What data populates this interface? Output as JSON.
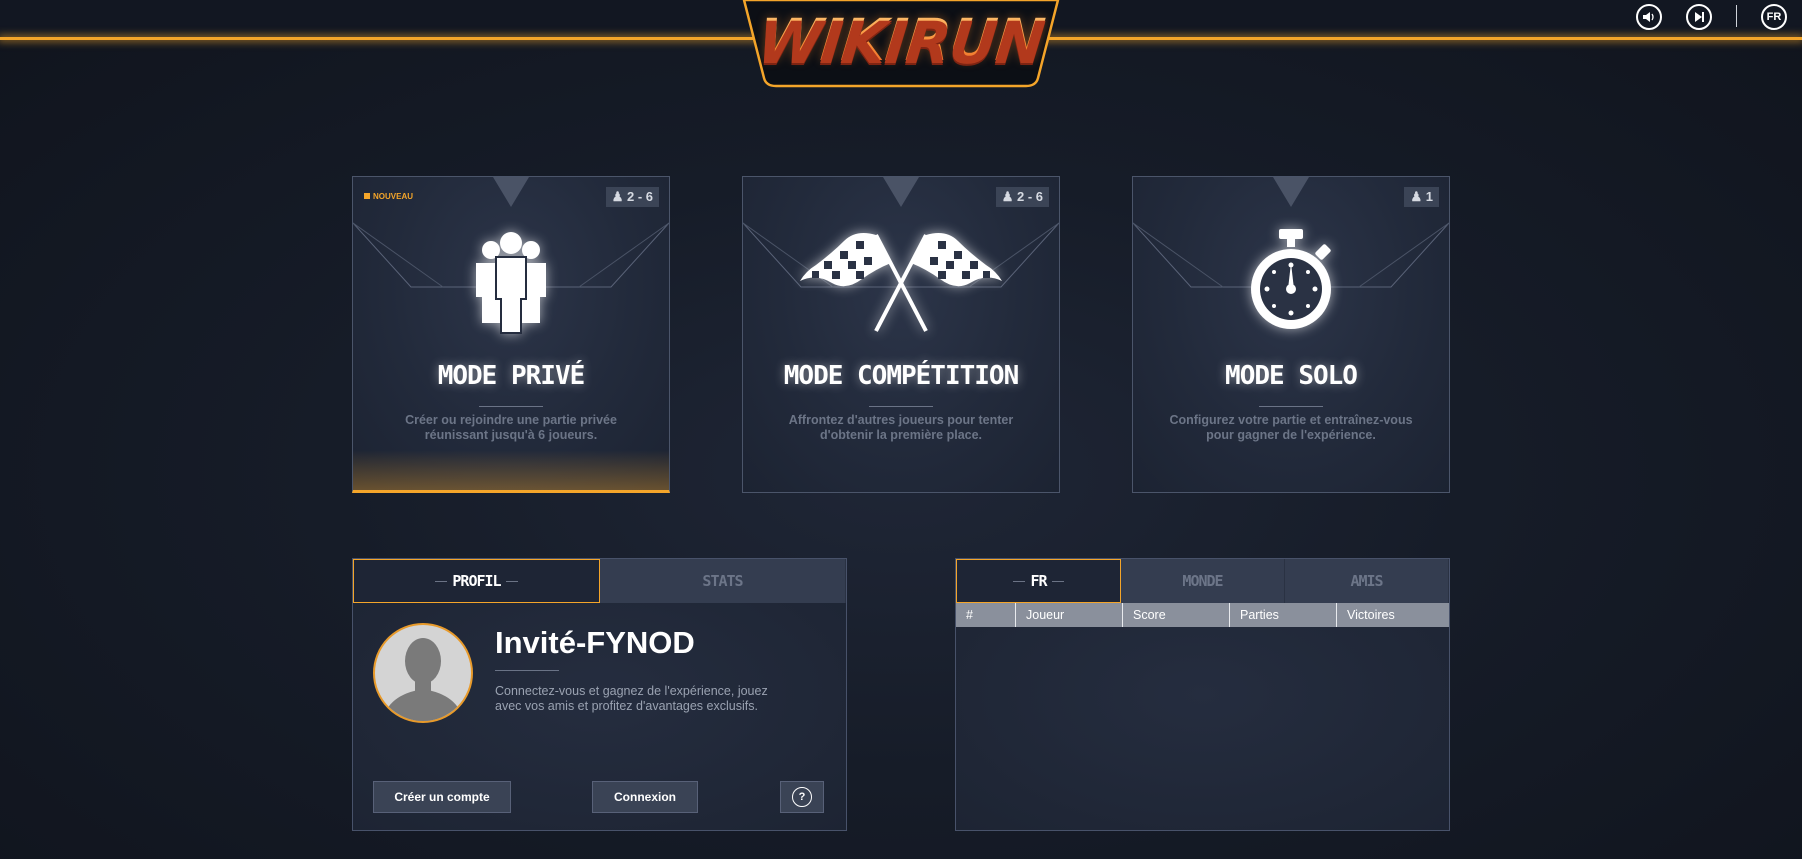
{
  "header": {
    "logo": "WIKIRUN",
    "language": "FR",
    "sound_icon": "speaker-icon",
    "skip_icon": "skip-next-icon"
  },
  "modes": [
    {
      "tag": "NOUVEAU",
      "players": "2 - 6",
      "icon": "group-icon",
      "title": "MODE PRIVÉ",
      "description": "Créer ou rejoindre une partie privée réunissant jusqu'à 6 joueurs."
    },
    {
      "players": "2 - 6",
      "icon": "checkered-flags-icon",
      "title": "MODE COMPÉTITION",
      "description": "Affrontez d'autres joueurs pour tenter d'obtenir la première place."
    },
    {
      "players": "1",
      "icon": "stopwatch-icon",
      "title": "MODE SOLO",
      "description": "Configurez votre partie et entraînez-vous pour gagner de l'expérience."
    }
  ],
  "profile_panel": {
    "tabs": [
      "PROFIL",
      "STATS"
    ],
    "username": "Invité-FYNOD",
    "description": "Connectez-vous et gagnez de l'expérience, jouez avec vos amis et profitez d'avantages exclusifs.",
    "create_account": "Créer un compte",
    "login": "Connexion",
    "help": "?"
  },
  "ranking_panel": {
    "tabs": [
      "FR",
      "MONDE",
      "AMIS"
    ],
    "columns": [
      "#",
      "Joueur",
      "Score",
      "Parties",
      "Victoires"
    ]
  },
  "colors": {
    "accent": "#f4a52a",
    "background": "#161c28"
  }
}
